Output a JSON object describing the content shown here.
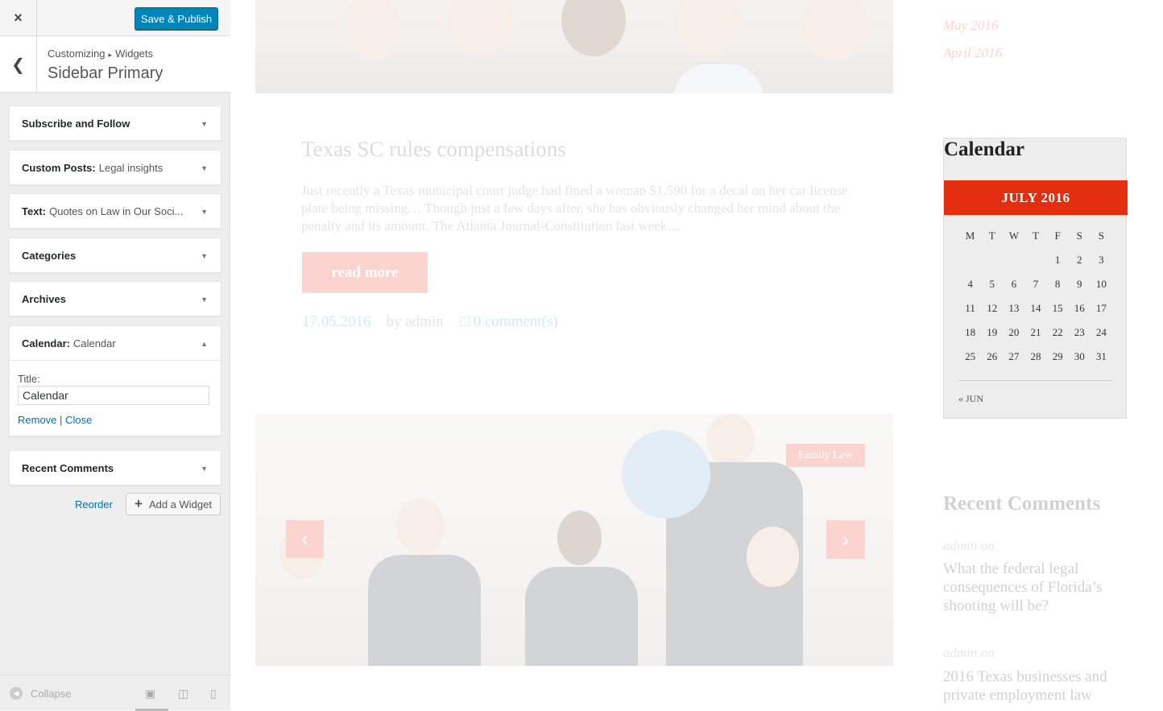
{
  "panel": {
    "close_icon": "×",
    "save_label": "Save & Publish",
    "breadcrumb": [
      "Customizing",
      "Widgets"
    ],
    "section_title": "Sidebar Primary",
    "widgets": [
      {
        "name": "Subscribe and Follow",
        "subtitle": "",
        "expanded": false
      },
      {
        "name": "Custom Posts:",
        "subtitle": "Legal insights",
        "expanded": false
      },
      {
        "name": "Text:",
        "subtitle": "Quotes on Law in Our Soci...",
        "expanded": false
      },
      {
        "name": "Categories",
        "subtitle": "",
        "expanded": false
      },
      {
        "name": "Archives",
        "subtitle": "",
        "expanded": false
      },
      {
        "name": "Calendar:",
        "subtitle": "Calendar",
        "expanded": true
      },
      {
        "name": "Recent Comments",
        "subtitle": "",
        "expanded": false
      }
    ],
    "calendar_form": {
      "title_label": "Title:",
      "title_value": "Calendar",
      "remove_label": "Remove",
      "separator": "|",
      "close_label": "Close"
    },
    "reorder_label": "Reorder",
    "add_widget_label": "Add a Widget",
    "collapse_label": "Collapse"
  },
  "preview": {
    "archives": [
      "May 2016",
      "April 2016"
    ],
    "post": {
      "title": "Texas SC rules compensations",
      "excerpt": "Just recently a Texas municipal court judge had fined a woman $1,590 for a decal on her car license plate being missing… Though just a few days after, she has obviously changed her mind about the penalty and its amount. The Atlanta Journal-Constitution last week…",
      "read_more": "read more",
      "date": "17.05.2016",
      "author": "by admin",
      "comments": "0 comment(s)"
    },
    "category_tag": "Family Law",
    "calendar": {
      "title": "Calendar",
      "month": "JULY 2016",
      "weekdays": [
        "M",
        "T",
        "W",
        "T",
        "F",
        "S",
        "S"
      ],
      "weeks": [
        [
          "",
          "",
          "",
          "",
          "1",
          "2",
          "3"
        ],
        [
          "4",
          "5",
          "6",
          "7",
          "8",
          "9",
          "10"
        ],
        [
          "11",
          "12",
          "13",
          "14",
          "15",
          "16",
          "17"
        ],
        [
          "18",
          "19",
          "20",
          "21",
          "22",
          "23",
          "24"
        ],
        [
          "25",
          "26",
          "27",
          "28",
          "29",
          "30",
          "31"
        ]
      ],
      "prev_link": "« JUN"
    },
    "recent_comments": {
      "title": "Recent Comments",
      "items": [
        {
          "author": "admin on",
          "link": "What the federal legal consequences of Florida’s shooting will be?"
        },
        {
          "author": "admin on",
          "link": "2016 Texas businesses and private employment law"
        }
      ]
    }
  },
  "colors": {
    "accent_blue": "#0085ba",
    "brand_red": "#e22d0e",
    "link_blue": "#0073aa"
  }
}
